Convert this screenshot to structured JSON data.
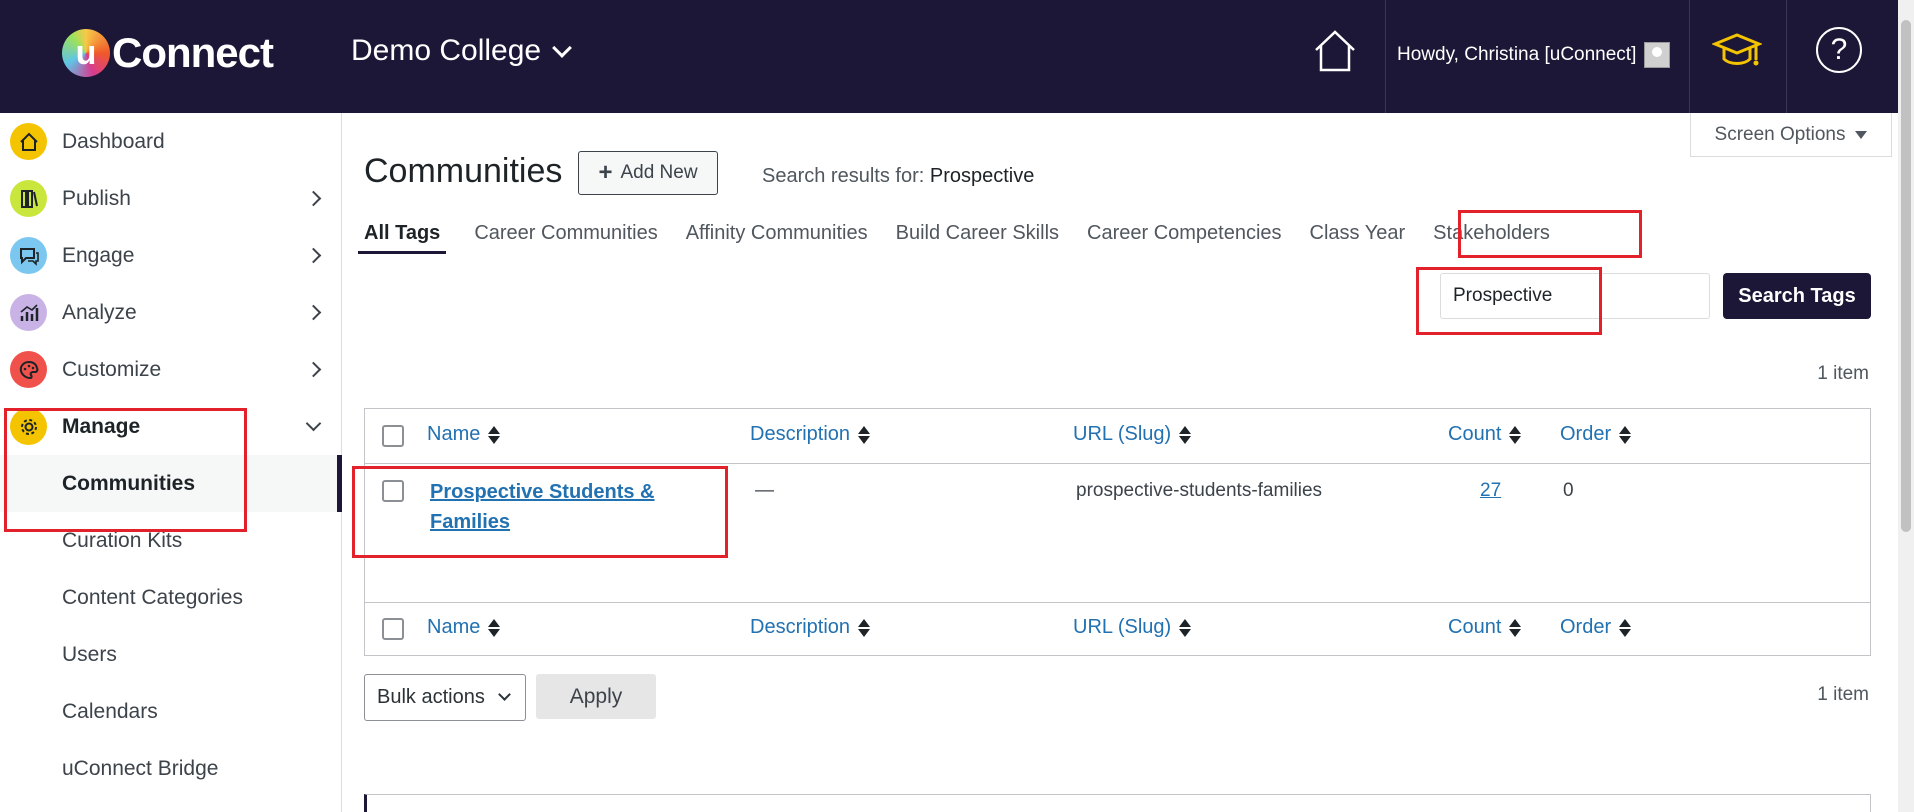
{
  "header": {
    "logo_letter": "u",
    "logo_word": "Connect",
    "college": "Demo College",
    "howdy": "Howdy, Christina [uConnect]",
    "help_glyph": "?"
  },
  "sidebar": {
    "items": [
      {
        "label": "Dashboard",
        "icon": "home-icon",
        "color": "#f5c400"
      },
      {
        "label": "Publish",
        "icon": "books-icon",
        "color": "#c8e63c"
      },
      {
        "label": "Engage",
        "icon": "chat-icon",
        "color": "#7cc7ef"
      },
      {
        "label": "Analyze",
        "icon": "chart-icon",
        "color": "#c9b3e6"
      },
      {
        "label": "Customize",
        "icon": "palette-icon",
        "color": "#f0524b"
      },
      {
        "label": "Manage",
        "icon": "gear-icon",
        "color": "#f5c400"
      }
    ],
    "sub_items": [
      "Communities",
      "Curation Kits",
      "Content Categories",
      "Users",
      "Calendars",
      "uConnect Bridge"
    ]
  },
  "main": {
    "screen_options": "Screen Options",
    "title": "Communities",
    "add_new": "Add New",
    "search_results_prefix": "Search results for:",
    "search_term": "Prospective",
    "tabs": [
      "All Tags",
      "Career Communities",
      "Affinity Communities",
      "Build Career Skills",
      "Career Competencies",
      "Class Year",
      "Stakeholders"
    ],
    "search_value": "Prospective",
    "search_button": "Search Tags",
    "item_count": "1 item",
    "columns": [
      "Name",
      "Description",
      "URL (Slug)",
      "Count",
      "Order"
    ],
    "rows": [
      {
        "name": "Prospective Students & Families",
        "description": "—",
        "slug": "prospective-students-families",
        "count": "27",
        "order": "0"
      }
    ],
    "bulk_actions": "Bulk actions",
    "apply": "Apply"
  }
}
